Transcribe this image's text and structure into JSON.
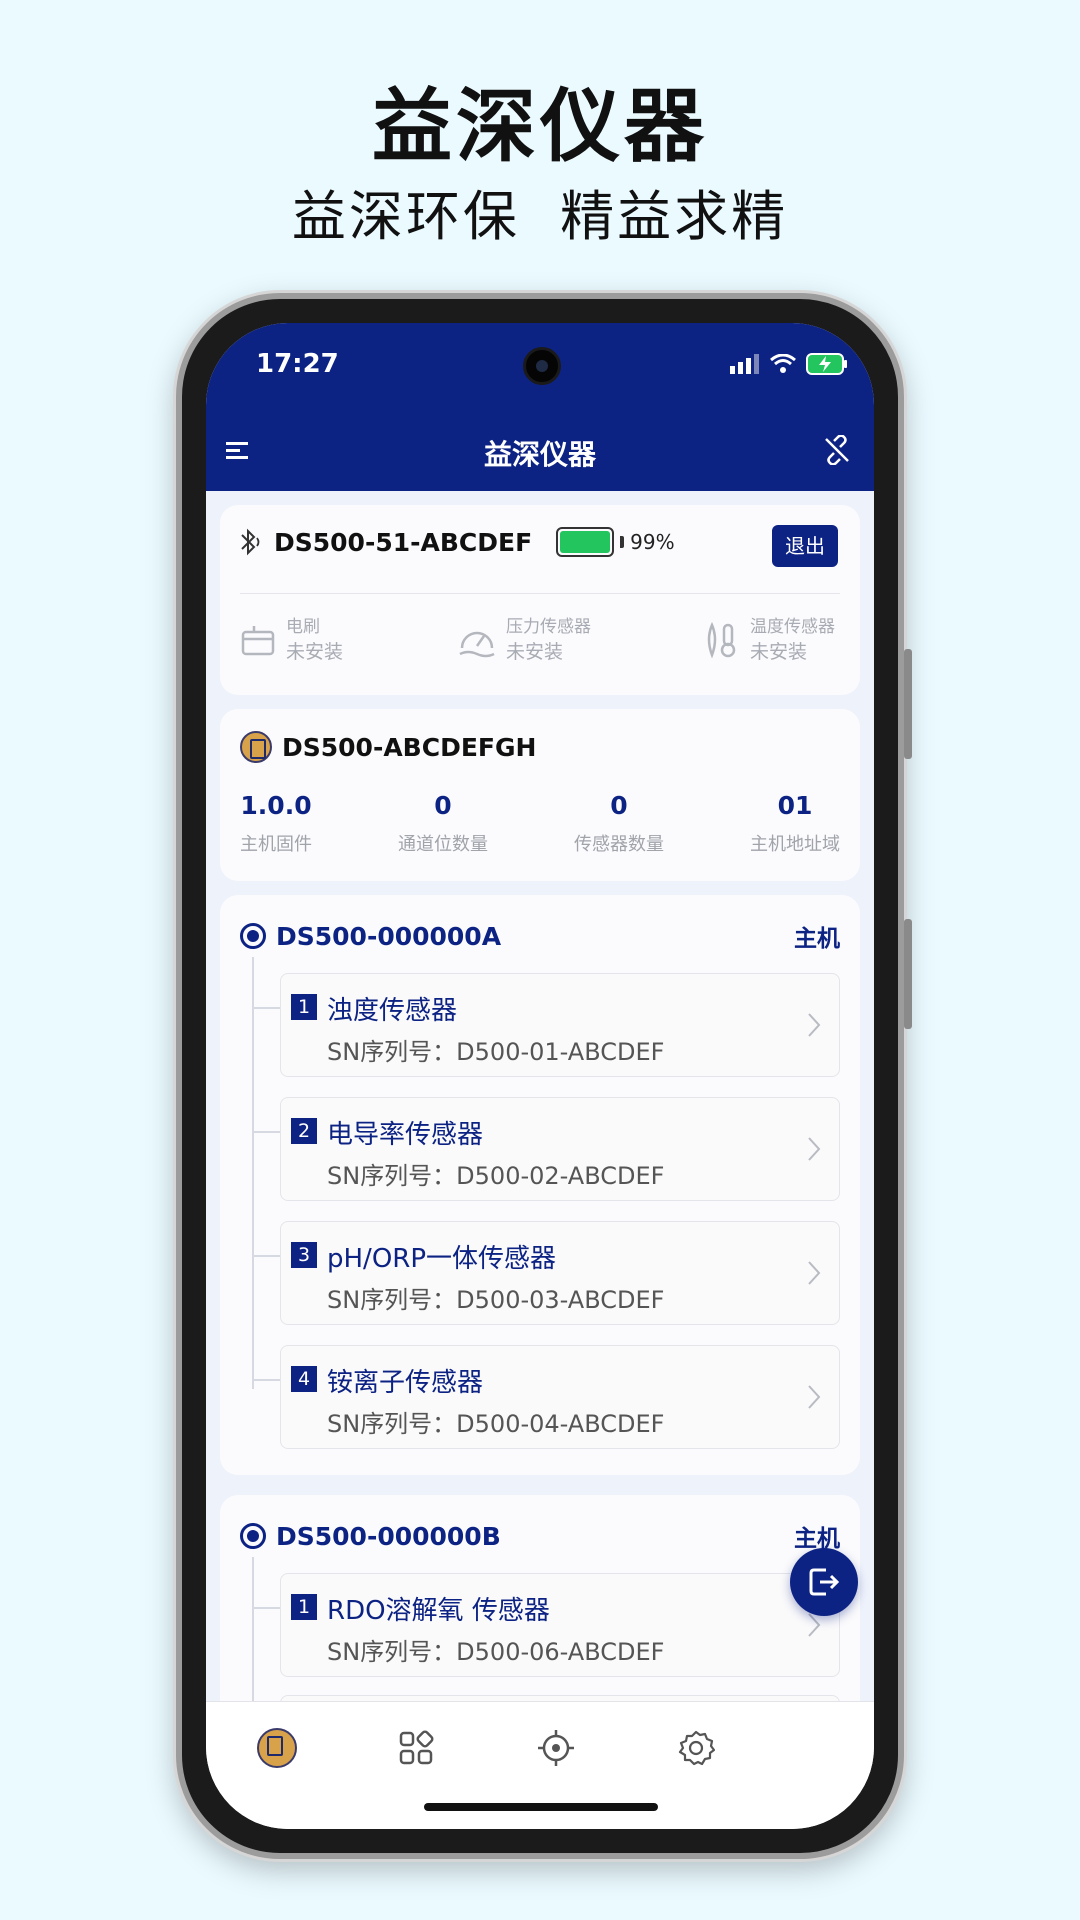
{
  "promo": {
    "title": "益深仪器",
    "subtitle": "益深环保  精益求精"
  },
  "status_bar": {
    "time": "17:27"
  },
  "nav": {
    "title": "益深仪器"
  },
  "device": {
    "name": "DS500-51-ABCDEF",
    "battery_percent": "99%",
    "battery_level": 0.99,
    "exit_label": "退出",
    "components": [
      {
        "label": "电刷",
        "status": "未安装"
      },
      {
        "label": "压力传感器",
        "status": "未安装"
      },
      {
        "label": "温度传感器",
        "status": "未安装"
      }
    ]
  },
  "host": {
    "name": "DS500-ABCDEFGH",
    "stats": [
      {
        "value": "1.0.0",
        "caption": "主机固件"
      },
      {
        "value": "0",
        "caption": "通道位数量"
      },
      {
        "value": "0",
        "caption": "传感器数量"
      },
      {
        "value": "01",
        "caption": "主机地址域"
      }
    ]
  },
  "nodes": [
    {
      "name": "DS500-000000A",
      "role": "主机",
      "sensors": [
        {
          "index": "1",
          "name": "浊度传感器",
          "sn": "SN序列号：D500-01-ABCDEF"
        },
        {
          "index": "2",
          "name": "电导率传感器",
          "sn": "SN序列号：D500-02-ABCDEF"
        },
        {
          "index": "3",
          "name": "pH/ORP一体传感器",
          "sn": "SN序列号：D500-03-ABCDEF"
        },
        {
          "index": "4",
          "name": "铵离子传感器",
          "sn": "SN序列号：D500-04-ABCDEF"
        }
      ]
    },
    {
      "name": "DS500-000000B",
      "role": "主机",
      "sensors": [
        {
          "index": "1",
          "name": "RDO溶解氧 传感器",
          "sn": "SN序列号：D500-06-ABCDEF"
        }
      ]
    }
  ],
  "icons": {
    "menu": "menu-icon",
    "link_off": "link-off-icon",
    "bluetooth": "bluetooth-icon",
    "fab": "logout-icon",
    "tabs": [
      "home-logo-icon",
      "apps-grid-icon",
      "crosshair-icon",
      "gear-icon"
    ]
  },
  "colors": {
    "primary": "#0d2384",
    "background": "#eafaff",
    "battery": "#22c55e"
  }
}
